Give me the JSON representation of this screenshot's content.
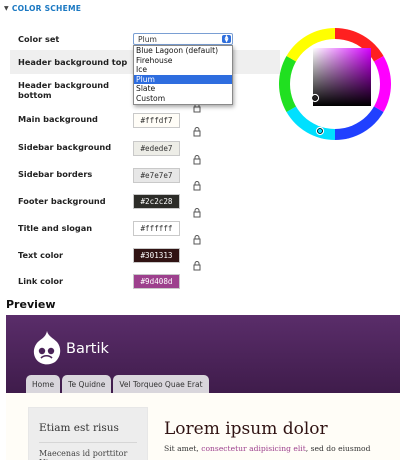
{
  "section": {
    "title": "COLOR SCHEME"
  },
  "color_set": {
    "label": "Color set",
    "selected": "Plum",
    "options": [
      "Blue Lagoon (default)",
      "Firehouse",
      "Ice",
      "Plum",
      "Slate",
      "Custom"
    ],
    "highlighted": "Plum"
  },
  "fields": [
    {
      "label": "Header background top",
      "value": "",
      "color": "#4c1c58"
    },
    {
      "label": "Header background bottom",
      "value": "",
      "color": "#593662"
    },
    {
      "label": "Main background",
      "value": "#fffdf7",
      "color": "#fffdf7",
      "text_color": "#333333"
    },
    {
      "label": "Sidebar background",
      "value": "#edede7",
      "color": "#edede7",
      "text_color": "#333333"
    },
    {
      "label": "Sidebar borders",
      "value": "#e7e7e7",
      "color": "#e7e7e7",
      "text_color": "#333333"
    },
    {
      "label": "Footer background",
      "value": "#2c2c28",
      "color": "#2c2c28",
      "text_color": "#ffffff"
    },
    {
      "label": "Title and slogan",
      "value": "#ffffff",
      "color": "#ffffff",
      "text_color": "#333333"
    },
    {
      "label": "Text color",
      "value": "#301313",
      "color": "#301313",
      "text_color": "#ffffff"
    },
    {
      "label": "Link color",
      "value": "#9d408d",
      "color": "#9d408d",
      "text_color": "#ffffff"
    }
  ],
  "wheel": {
    "accent_color": "#4c1c58"
  },
  "preview": {
    "title": "Preview",
    "site_name": "Bartik",
    "tabs": [
      "Home",
      "Te Quidne",
      "Vel Torqueo Quae Erat"
    ],
    "sidebar_title": "Etiam est risus",
    "sidebar_text": "Maecenas id porttitor Ut",
    "main_title": "Lorem ipsum dolor",
    "main_text_before": "Sit amet, ",
    "main_text_link": "consectetur adipisicing elit",
    "main_text_after": ", sed do eiusmod",
    "header_top_color": "#5a2d6a",
    "header_bottom_color": "#3f1c4b"
  }
}
